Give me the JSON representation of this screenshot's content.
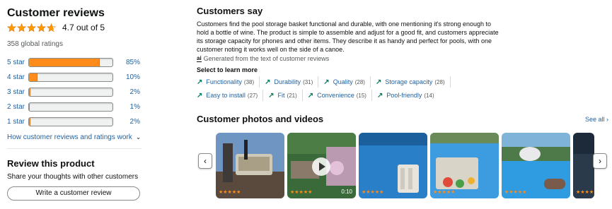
{
  "reviews": {
    "title": "Customer reviews",
    "average_text": "4.7 out of 5",
    "average_value": 4.7,
    "total_ratings": "358 global ratings",
    "histogram": [
      {
        "label": "5 star",
        "pct_text": "85%",
        "fraction": 0.85
      },
      {
        "label": "4 star",
        "pct_text": "10%",
        "fraction": 0.1
      },
      {
        "label": "3 star",
        "pct_text": "2%",
        "fraction": 0.02
      },
      {
        "label": "2 star",
        "pct_text": "1%",
        "fraction": 0.01
      },
      {
        "label": "1 star",
        "pct_text": "2%",
        "fraction": 0.02
      }
    ],
    "how_link": "How customer reviews and ratings work"
  },
  "review_product": {
    "title": "Review this product",
    "share_text": "Share your thoughts with other customers",
    "button_label": "Write a customer review"
  },
  "customers_say": {
    "title": "Customers say",
    "summary": "Customers find the pool storage basket functional and durable, with one mentioning it's strong enough to hold a bottle of wine. The product is simple to assemble and adjust for a good fit, and customers appreciate its storage capacity for phones and other items. They describe it as handy and perfect for pools, with one customer noting it works well on the side of a canoe.",
    "generated_text": "Generated from the text of customer reviews",
    "ai_badge": "ai",
    "select_label": "Select to learn more",
    "aspects": [
      {
        "label": "Functionality",
        "count": "(38)"
      },
      {
        "label": "Durability",
        "count": "(31)"
      },
      {
        "label": "Quality",
        "count": "(28)"
      },
      {
        "label": "Storage capacity",
        "count": "(28)"
      },
      {
        "label": "Easy to install",
        "count": "(27)"
      },
      {
        "label": "Fit",
        "count": "(21)"
      },
      {
        "label": "Convenience",
        "count": "(15)"
      },
      {
        "label": "Pool-friendly",
        "count": "(14)"
      }
    ]
  },
  "photos": {
    "title": "Customer photos and videos",
    "see_all": "See all ›",
    "prev_icon": "‹",
    "next_icon": "›",
    "items": [
      {
        "rating": "★★★★★",
        "duration": ""
      },
      {
        "rating": "★★★★★",
        "duration": "0:10"
      },
      {
        "rating": "★★★★★",
        "duration": ""
      },
      {
        "rating": "★★★★★",
        "duration": ""
      },
      {
        "rating": "★★★★★",
        "duration": ""
      },
      {
        "rating": "★★★★★",
        "duration": ""
      }
    ]
  },
  "colors": {
    "star": "#ff9900",
    "bar_fill": "#ff8c1a",
    "link": "#2162a1",
    "aspect_arrow": "#067d62"
  }
}
